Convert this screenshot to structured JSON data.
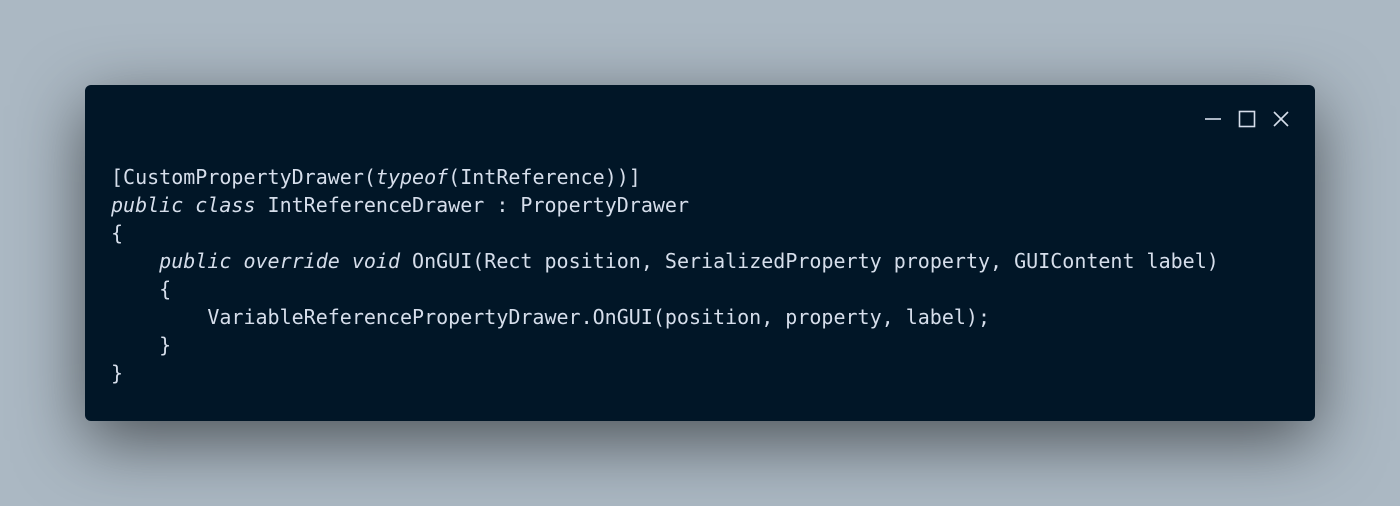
{
  "window": {
    "controls": {
      "minimize_icon": "minimize-icon",
      "maximize_icon": "maximize-icon",
      "close_icon": "close-icon"
    }
  },
  "code": {
    "lines": [
      {
        "indent": "",
        "tokens": [
          {
            "text": "[CustomPropertyDrawer(",
            "style": "plain"
          },
          {
            "text": "typeof",
            "style": "kw"
          },
          {
            "text": "(IntReference))]",
            "style": "plain"
          }
        ]
      },
      {
        "indent": "",
        "tokens": [
          {
            "text": "public",
            "style": "kw"
          },
          {
            "text": " ",
            "style": "plain"
          },
          {
            "text": "class",
            "style": "kw"
          },
          {
            "text": " IntReferenceDrawer : PropertyDrawer",
            "style": "plain"
          }
        ]
      },
      {
        "indent": "",
        "tokens": [
          {
            "text": "{",
            "style": "plain"
          }
        ]
      },
      {
        "indent": "    ",
        "tokens": [
          {
            "text": "public",
            "style": "kw"
          },
          {
            "text": " ",
            "style": "plain"
          },
          {
            "text": "override",
            "style": "kw"
          },
          {
            "text": " ",
            "style": "plain"
          },
          {
            "text": "void",
            "style": "kw"
          },
          {
            "text": " OnGUI(Rect position, SerializedProperty property, GUIContent label)",
            "style": "plain"
          }
        ]
      },
      {
        "indent": "    ",
        "tokens": [
          {
            "text": "{",
            "style": "plain"
          }
        ]
      },
      {
        "indent": "        ",
        "tokens": [
          {
            "text": "VariableReferencePropertyDrawer.OnGUI(position, property, label);",
            "style": "plain"
          }
        ]
      },
      {
        "indent": "    ",
        "tokens": [
          {
            "text": "}",
            "style": "plain"
          }
        ]
      },
      {
        "indent": "",
        "tokens": [
          {
            "text": "}",
            "style": "plain"
          }
        ]
      }
    ]
  },
  "colors": {
    "background": "#abb8c3",
    "window": "#011627",
    "code_text": "#d6deeb",
    "controls": "#d6deeb"
  }
}
